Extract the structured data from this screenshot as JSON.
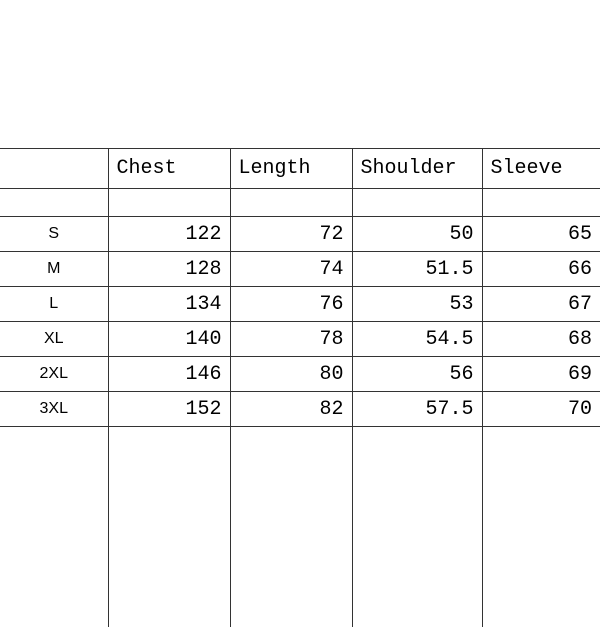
{
  "chart_data": {
    "type": "table",
    "title": "",
    "columns": [
      "",
      "Chest",
      "Length",
      "Shoulder",
      "Sleeve"
    ],
    "rows": [
      {
        "size": "S",
        "chest": 122,
        "length": 72,
        "shoulder": 50,
        "sleeve": 65
      },
      {
        "size": "M",
        "chest": 128,
        "length": 74,
        "shoulder": 51.5,
        "sleeve": 66
      },
      {
        "size": "L",
        "chest": 134,
        "length": 76,
        "shoulder": 53,
        "sleeve": 67
      },
      {
        "size": "XL",
        "chest": 140,
        "length": 78,
        "shoulder": 54.5,
        "sleeve": 68
      },
      {
        "size": "2XL",
        "chest": 146,
        "length": 80,
        "shoulder": 56,
        "sleeve": 69
      },
      {
        "size": "3XL",
        "chest": 152,
        "length": 82,
        "shoulder": 57.5,
        "sleeve": 70
      }
    ]
  }
}
